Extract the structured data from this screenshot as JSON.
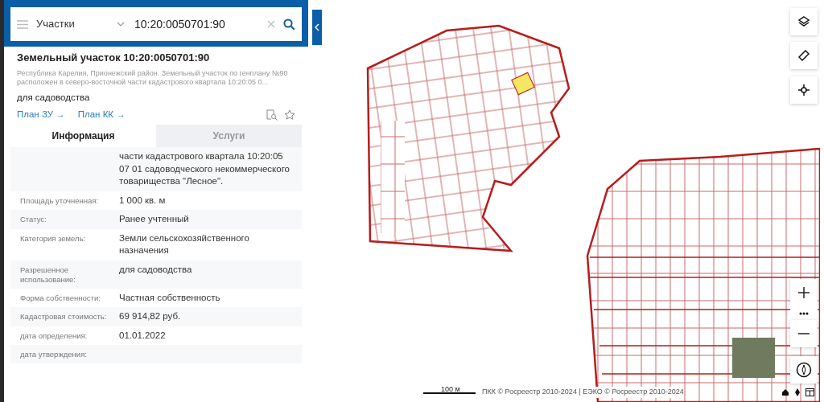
{
  "search": {
    "category": "Участки",
    "query": "10:20:0050701:90"
  },
  "card": {
    "title": "Земельный участок 10:20:0050701:90",
    "address": "Республика Карелия, Прионежский район. Земельный участок по генплану №90 расположен в северо-восточной части кадастрового квартала 10:20:05 0...",
    "purpose": "для садоводства",
    "links": [
      "План ЗУ →",
      "План КК →"
    ]
  },
  "tabs": [
    {
      "label": "Информация",
      "selected": true
    },
    {
      "label": "Услуги",
      "selected": false
    }
  ],
  "info_rows": [
    {
      "value": "части кадастрового квартала 10:20:05 07 01 садоводческого некоммерческого товарищества \"Лесное\"."
    },
    {
      "label": "Площадь уточненная:",
      "value": "1 000 кв. м"
    },
    {
      "label": "Статус:",
      "value": "Ранее учтенный"
    },
    {
      "label": "Категория земель:",
      "value": "Земли сельскохозяйственного назначения"
    },
    {
      "label": "Разрешенное использование:",
      "value": "для садоводства"
    },
    {
      "label": "Форма собственности:",
      "value": "Частная собственность"
    },
    {
      "label": "Кадастровая стоимость:",
      "value": "69 914,82 руб."
    },
    {
      "label": "дата определения:",
      "value": "01.01.2022"
    },
    {
      "label": "дата утверждения:"
    }
  ],
  "map": {
    "scale": "100 м",
    "attribution": "ПКК © Росреестр 2010-2024 | ЕЭКО © Росреестр 2010-2024"
  }
}
